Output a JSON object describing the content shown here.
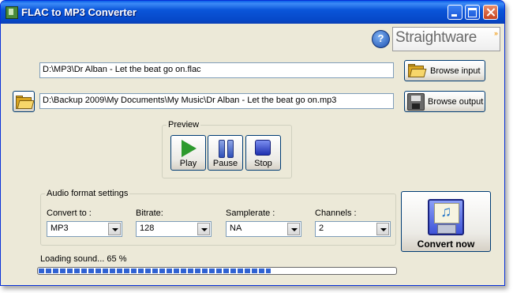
{
  "window": {
    "title": "FLAC to MP3 Converter"
  },
  "brand": {
    "name": "Straightware",
    "help_label": "?"
  },
  "input": {
    "path": "D:\\MP3\\Dr Alban - Let the beat go on.flac",
    "browse_label": "Browse input"
  },
  "output": {
    "path": "D:\\Backup 2009\\My Documents\\My Music\\Dr Alban - Let the beat go on.mp3",
    "browse_label": "Browse output"
  },
  "preview": {
    "legend": "Preview",
    "play_label": "Play",
    "pause_label": "Pause",
    "stop_label": "Stop"
  },
  "audio_settings": {
    "legend": "Audio format settings",
    "convert_to": {
      "label": "Convert to :",
      "value": "MP3"
    },
    "bitrate": {
      "label": "Bitrate:",
      "value": "128"
    },
    "samplerate": {
      "label": "Samplerate :",
      "value": "NA"
    },
    "channels": {
      "label": "Channels :",
      "value": "2"
    }
  },
  "convert_button": {
    "label": "Convert now"
  },
  "status": {
    "text": "Loading sound... 65 %",
    "progress_percent": 65
  },
  "colors": {
    "titlebar": "#0a55d9",
    "window_bg": "#ece9d8",
    "progress": "#2f62d3"
  }
}
